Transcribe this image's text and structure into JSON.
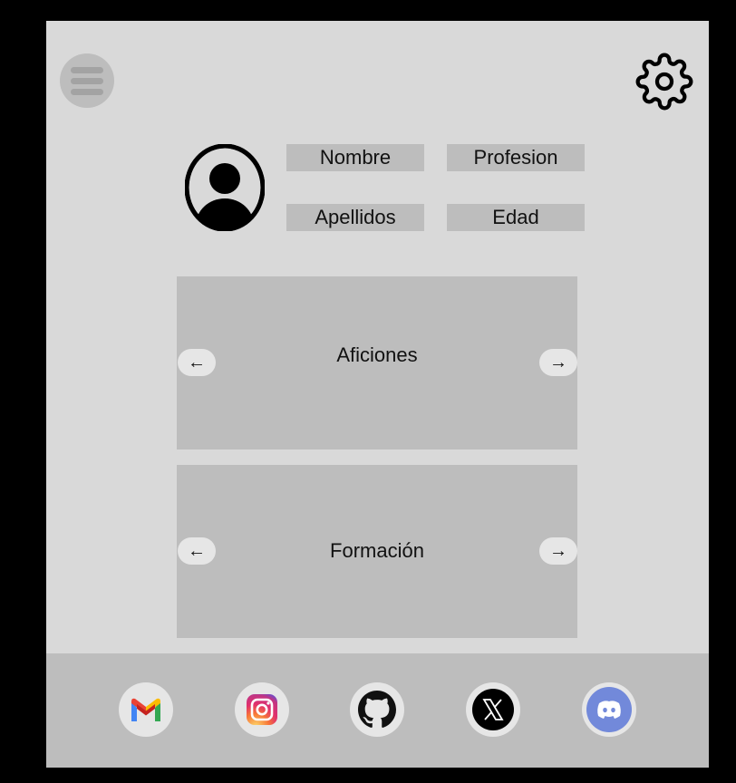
{
  "header": {
    "menu_icon": "hamburger-icon",
    "settings_icon": "gear-icon"
  },
  "profile": {
    "avatar_icon": "user-avatar-icon",
    "fields": {
      "nombre": "Nombre",
      "profesion": "Profesion",
      "apellidos": "Apellidos",
      "edad": "Edad"
    }
  },
  "cards": {
    "aficiones": {
      "title": "Aficiones",
      "prev": "←",
      "next": "→"
    },
    "formacion": {
      "title": "Formación",
      "prev": "←",
      "next": "→"
    }
  },
  "footer": {
    "socials": [
      {
        "name": "gmail",
        "icon": "gmail-icon"
      },
      {
        "name": "instagram",
        "icon": "instagram-icon"
      },
      {
        "name": "github",
        "icon": "github-icon"
      },
      {
        "name": "x",
        "icon": "x-icon"
      },
      {
        "name": "discord",
        "icon": "discord-icon"
      }
    ]
  },
  "colors": {
    "page_bg": "#000000",
    "panel_bg": "#d9d9d9",
    "block_bg": "#bdbdbd",
    "button_bg": "#e6e6e6",
    "discord": "#7289da"
  }
}
